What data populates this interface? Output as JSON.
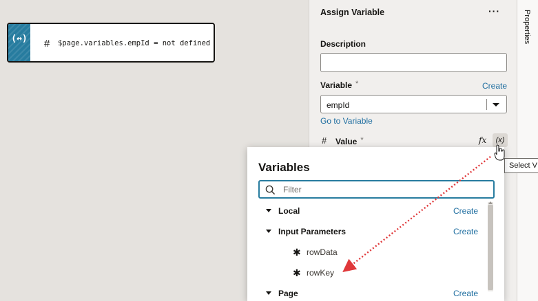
{
  "canvas": {
    "node": {
      "icon": "(↔)",
      "hash": "#",
      "expression": "$page.variables.empId = not defined"
    }
  },
  "panel": {
    "title": "Assign Variable",
    "more": "···",
    "description": {
      "label": "Description",
      "value": ""
    },
    "variable": {
      "label": "Variable",
      "required": "*",
      "create": "Create",
      "value": "empId",
      "goto": "Go to Variable"
    },
    "value": {
      "hash": "#",
      "label": "Value",
      "required": "*",
      "fx": "fx",
      "x_button": "(x)"
    }
  },
  "rail": {
    "tab": "Properties"
  },
  "tooltip": {
    "text": "Select V"
  },
  "popup": {
    "title": "Variables",
    "filter_placeholder": "Filter",
    "filter_value": "",
    "groups": [
      {
        "label": "Local",
        "create": "Create"
      },
      {
        "label": "Input Parameters",
        "create": "Create",
        "items": [
          {
            "label": "rowData"
          },
          {
            "label": "rowKey"
          }
        ]
      },
      {
        "label": "Page",
        "create": "Create"
      }
    ]
  },
  "colors": {
    "accent": "#277c9f",
    "link": "#1f6ea0",
    "annotation_arrow": "#e0383a"
  }
}
